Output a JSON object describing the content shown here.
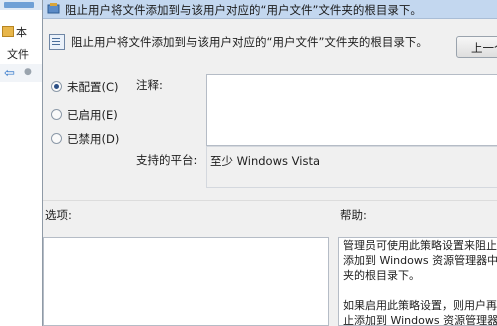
{
  "background_window": {
    "row1_text": "本",
    "row2_text": "文件"
  },
  "dialog": {
    "title": "阻止用户将文件添加到与该用户对应的“用户文件”文件夹的根目录下。",
    "setting_name": "阻止用户将文件添加到与该用户对应的“用户文件”文件夹的根目录下。",
    "prev_button": "上一个"
  },
  "state": {
    "options": [
      {
        "label": "未配置(C)",
        "checked": true
      },
      {
        "label": "已启用(E)",
        "checked": false
      },
      {
        "label": "已禁用(D)",
        "checked": false
      }
    ]
  },
  "comment": {
    "label": "注释:",
    "value": ""
  },
  "platform": {
    "label": "支持的平台:",
    "value": "至少 Windows Vista"
  },
  "options_section": {
    "label": "选项:"
  },
  "help_section": {
    "label": "帮助:",
    "lines": [
      "管理员可使用此策略设置来阻止",
      "添加到 Windows 资源管理器中",
      "夹的根目录下。",
      "如果启用此策略设置，则用户再",
      "止添加到 Windows 资源管理器"
    ]
  },
  "colors": {
    "titlebar": "#c3d7ef",
    "dialog_bg": "#f0f0f0",
    "radio_selected": "#2c4f85"
  }
}
